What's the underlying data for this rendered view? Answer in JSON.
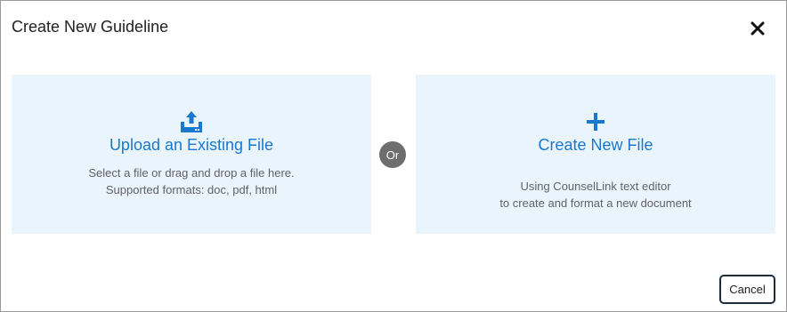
{
  "dialog": {
    "title": "Create New Guideline",
    "close_icon": "close-icon"
  },
  "upload_card": {
    "icon": "upload-icon",
    "title": "Upload an Existing File",
    "description_line1": "Select a file or drag and drop a file here.",
    "description_line2": "Supported formats: doc, pdf, html"
  },
  "separator": {
    "label": "Or"
  },
  "create_card": {
    "icon": "plus-icon",
    "title": "Create New File",
    "description_line1": "Using CounselLink text editor",
    "description_line2": "to create and format a new document"
  },
  "footer": {
    "cancel_label": "Cancel"
  },
  "colors": {
    "accent": "#1a78cf",
    "card_background": "#eaf4fc",
    "or_badge": "#6e6e6e",
    "text_dark": "#202122",
    "text_muted": "#5f6368"
  }
}
